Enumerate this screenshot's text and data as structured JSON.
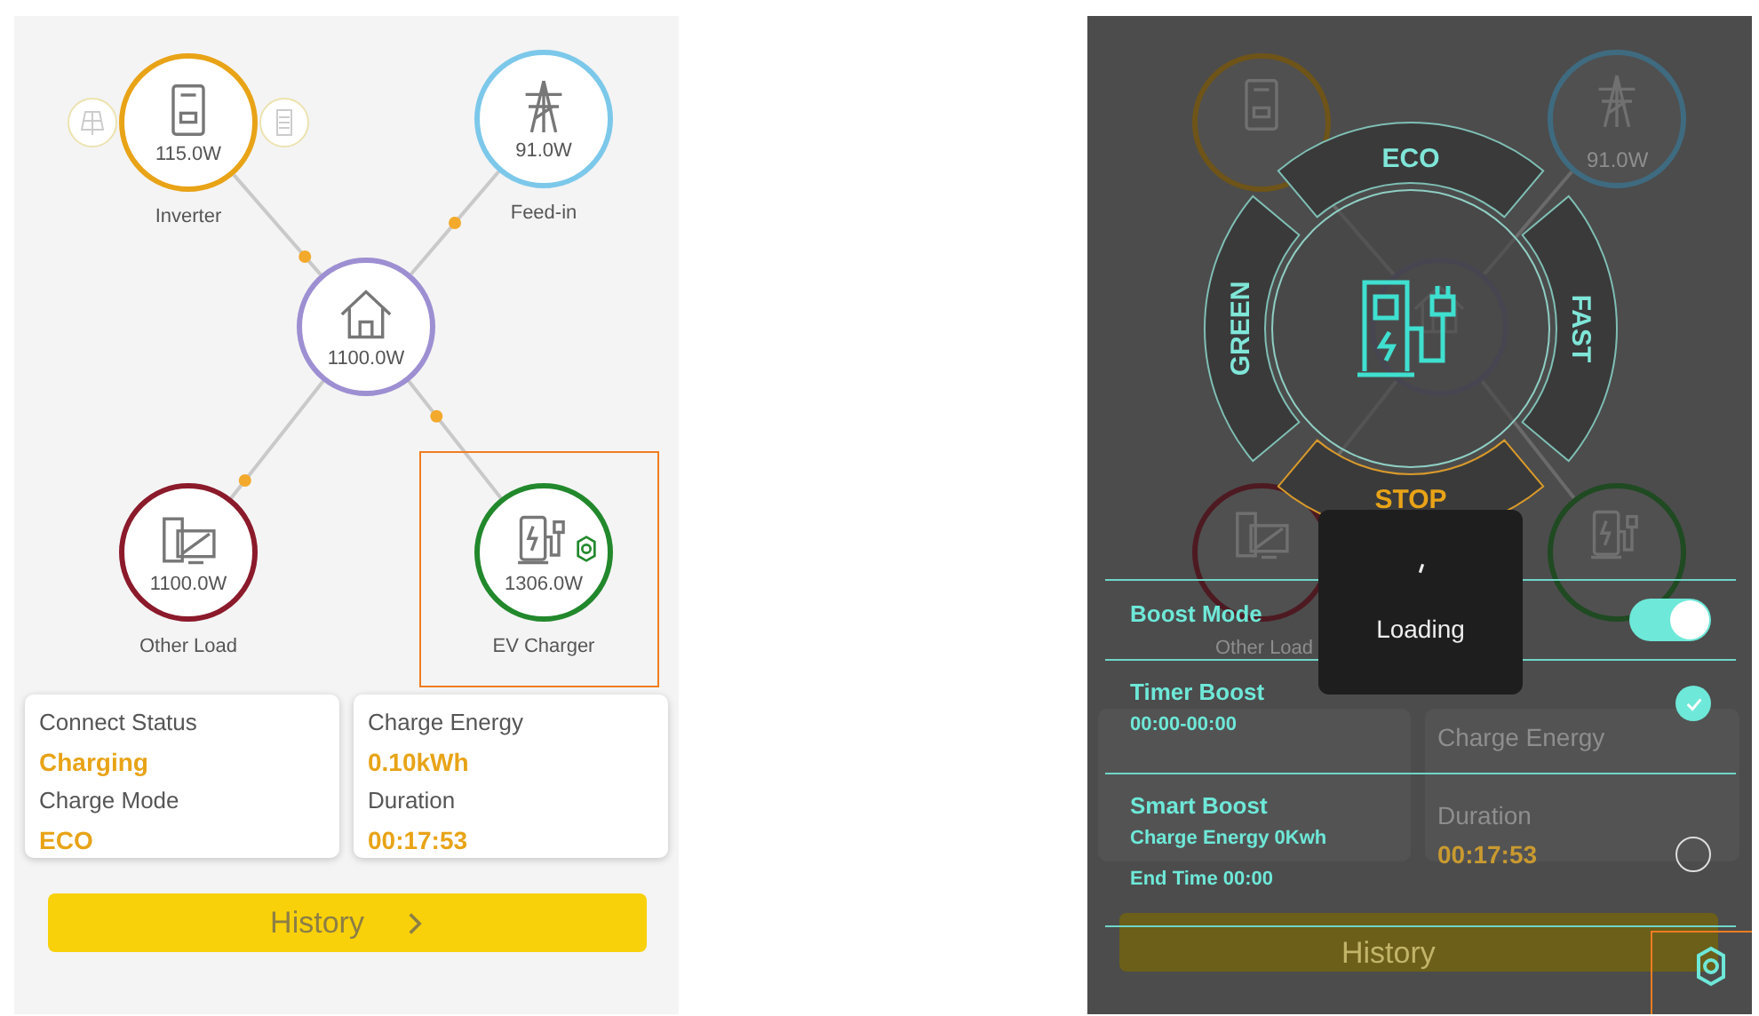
{
  "main_screen": {
    "nodes": [
      {
        "kind": "inverter",
        "value": "115.0W",
        "label": "Inverter",
        "color": "#e8a317",
        "highlighted": false
      },
      {
        "kind": "grid",
        "value": "91.0W",
        "label": "Feed-in",
        "color": "#7cc8ea",
        "highlighted": false
      },
      {
        "kind": "home",
        "value": "1100.0W",
        "color": "#9d8fd2",
        "highlighted": false
      },
      {
        "kind": "load",
        "value": "1100.0W",
        "label": "Other Load",
        "color": "#8b1a2b",
        "highlighted": false
      },
      {
        "kind": "ev",
        "value": "1306.0W",
        "label": "EV Charger",
        "color": "#22882c",
        "highlighted": true
      }
    ],
    "cards": [
      {
        "items": [
          {
            "label": "Connect Status",
            "value": "Charging"
          },
          {
            "label": "Charge Mode",
            "value": "ECO"
          }
        ]
      },
      {
        "items": [
          {
            "label": "Charge Energy",
            "value": "0.10kWh"
          },
          {
            "label": "Duration",
            "value": "00:17:53"
          }
        ]
      }
    ],
    "history_button": "History"
  },
  "mode_screen": {
    "background": {
      "node_texts": [
        {
          "kind": "value",
          "text": "91.0W"
        },
        {
          "kind": "label",
          "text": "Other Load"
        }
      ],
      "card_texts": [
        {
          "kind": "label",
          "text": "Charge Energy"
        },
        {
          "kind": "label",
          "text": "Duration"
        },
        {
          "kind": "value",
          "text": "00:17:53"
        }
      ],
      "history_button": "History"
    },
    "overlay": {
      "modes": [
        {
          "label": "ECO",
          "selected": false
        },
        {
          "label": "FAST",
          "selected": false
        },
        {
          "label": "STOP",
          "selected": true
        },
        {
          "label": "GREEN",
          "selected": false
        }
      ],
      "loading": "Loading",
      "boost_mode": {
        "label": "Boost Mode",
        "on": true
      },
      "options": [
        {
          "title": "Timer Boost",
          "details": [
            "00:00-00:00"
          ],
          "selected": true
        },
        {
          "title": "Smart Boost",
          "details": [
            "Charge Energy 0Kwh",
            "End Time 00:00"
          ],
          "selected": false
        }
      ],
      "settings_highlighted": true
    }
  }
}
